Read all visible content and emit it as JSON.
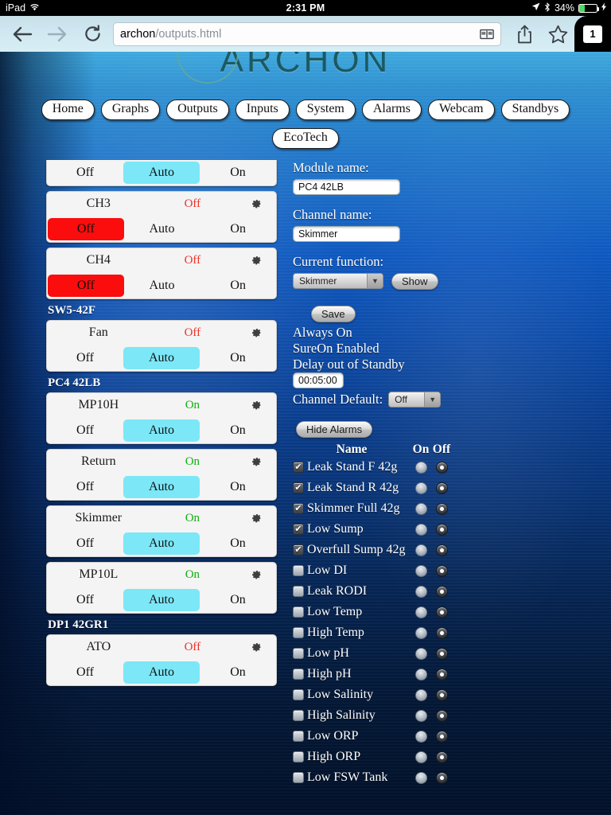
{
  "status_bar": {
    "device": "iPad",
    "wifi_icon": "wifi-icon",
    "time": "2:31 PM",
    "location_icon": "location-arrow-icon",
    "bluetooth_icon": "bluetooth-icon",
    "battery_percent": "34%",
    "battery_level": 34,
    "charging_icon": "lightning-bolt-icon"
  },
  "browser": {
    "back_icon": "back-arrow-icon",
    "forward_icon": "forward-arrow-icon",
    "reload_icon": "reload-icon",
    "url_host": "archon",
    "url_path": "/outputs.html",
    "url_full": "archon/outputs.html",
    "reader_icon": "reader-view-icon",
    "share_icon": "share-icon",
    "bookmark_icon": "bookmark-star-icon",
    "tab_count": "1"
  },
  "site": {
    "wordmark": "ARCHON",
    "main_nav": [
      {
        "label": "Home"
      },
      {
        "label": "Graphs"
      },
      {
        "label": "Outputs"
      },
      {
        "label": "Inputs"
      },
      {
        "label": "System"
      },
      {
        "label": "Alarms"
      },
      {
        "label": "Webcam"
      },
      {
        "label": "Standbys"
      }
    ],
    "sub_nav": [
      {
        "label": "EcoTech"
      }
    ]
  },
  "channels": {
    "clipped_card": {
      "buttons": {
        "off": "Off",
        "auto": "Auto",
        "on": "On"
      },
      "selected": "auto"
    },
    "groups": [
      {
        "module": null,
        "rows": [
          {
            "name": "CH3",
            "state": "Off",
            "state_class": "off",
            "gear": "gear-icon",
            "buttons": {
              "off": "Off",
              "auto": "Auto",
              "on": "On"
            },
            "selected": "off"
          },
          {
            "name": "CH4",
            "state": "Off",
            "state_class": "off",
            "gear": "gear-icon",
            "buttons": {
              "off": "Off",
              "auto": "Auto",
              "on": "On"
            },
            "selected": "off"
          }
        ]
      },
      {
        "module": "SW5-42F",
        "rows": [
          {
            "name": "Fan",
            "state": "Off",
            "state_class": "off",
            "gear": "gear-icon",
            "buttons": {
              "off": "Off",
              "auto": "Auto",
              "on": "On"
            },
            "selected": "auto"
          }
        ]
      },
      {
        "module": "PC4 42LB",
        "rows": [
          {
            "name": "MP10H",
            "state": "On",
            "state_class": "on",
            "gear": "gear-icon",
            "buttons": {
              "off": "Off",
              "auto": "Auto",
              "on": "On"
            },
            "selected": "auto"
          },
          {
            "name": "Return",
            "state": "On",
            "state_class": "on",
            "gear": "gear-icon",
            "buttons": {
              "off": "Off",
              "auto": "Auto",
              "on": "On"
            },
            "selected": "auto"
          },
          {
            "name": "Skimmer",
            "state": "On",
            "state_class": "on",
            "gear": "gear-icon",
            "buttons": {
              "off": "Off",
              "auto": "Auto",
              "on": "On"
            },
            "selected": "auto"
          },
          {
            "name": "MP10L",
            "state": "On",
            "state_class": "on",
            "gear": "gear-icon",
            "buttons": {
              "off": "Off",
              "auto": "Auto",
              "on": "On"
            },
            "selected": "auto"
          }
        ]
      },
      {
        "module": "DP1 42GR1",
        "rows": [
          {
            "name": "ATO",
            "state": "Off",
            "state_class": "off",
            "gear": "gear-icon",
            "buttons": {
              "off": "Off",
              "auto": "Auto",
              "on": "On"
            },
            "selected": "auto"
          }
        ]
      }
    ]
  },
  "detail": {
    "module_name_label": "Module name:",
    "module_name_value": "PC4 42LB",
    "channel_name_label": "Channel name:",
    "channel_name_value": "Skimmer",
    "current_function_label": "Current function:",
    "current_function_value": "Skimmer",
    "show_button": "Show",
    "save_button": "Save",
    "always_on": "Always On",
    "sure_on": "SureOn Enabled",
    "delay_label": "Delay out of Standby",
    "delay_value": "00:05:00",
    "channel_default_label": "Channel Default:",
    "channel_default_value": "Off",
    "hide_alarms_button": "Hide Alarms"
  },
  "alarms": {
    "col_name": "Name",
    "col_on": "On",
    "col_off": "Off",
    "rows": [
      {
        "name": "Leak Stand F 42g",
        "checked": true,
        "selected": "off"
      },
      {
        "name": "Leak Stand R 42g",
        "checked": true,
        "selected": "off"
      },
      {
        "name": "Skimmer Full 42g",
        "checked": true,
        "selected": "off"
      },
      {
        "name": "Low Sump",
        "checked": true,
        "selected": "off"
      },
      {
        "name": "Overfull Sump 42g",
        "checked": true,
        "selected": "off"
      },
      {
        "name": "Low DI",
        "checked": false,
        "selected": "off"
      },
      {
        "name": "Leak RODI",
        "checked": false,
        "selected": "off"
      },
      {
        "name": "Low Temp",
        "checked": false,
        "selected": "off"
      },
      {
        "name": "High Temp",
        "checked": false,
        "selected": "off"
      },
      {
        "name": "Low pH",
        "checked": false,
        "selected": "off"
      },
      {
        "name": "High pH",
        "checked": false,
        "selected": "off"
      },
      {
        "name": "Low Salinity",
        "checked": false,
        "selected": "off"
      },
      {
        "name": "High Salinity",
        "checked": false,
        "selected": "off"
      },
      {
        "name": "Low ORP",
        "checked": false,
        "selected": "off"
      },
      {
        "name": "High ORP",
        "checked": false,
        "selected": "off"
      },
      {
        "name": "Low FSW Tank",
        "checked": false,
        "selected": "off"
      }
    ]
  },
  "colors": {
    "auto_selected": "#7ce7f7",
    "off_selected": "#fb0d0d",
    "state_on": "#10b010",
    "state_off": "#e8322a",
    "battery_green": "#4cd964",
    "logo_teal": "#1b5a63"
  }
}
